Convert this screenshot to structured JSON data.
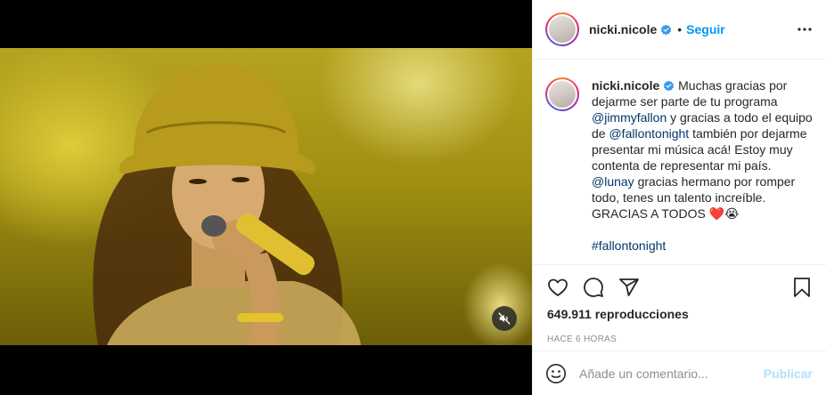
{
  "post": {
    "username": "nicki.nicole",
    "separator": "•",
    "follow_label": "Seguir",
    "more_icon": "more-options-icon",
    "verified_color": "#3897f0"
  },
  "caption": {
    "username": "nicki.nicole",
    "line1": " Muchas gracias por",
    "line2": "dejarme ser parte de tu programa",
    "mention1": "@jimmyfallon",
    "line3_rest": " y gracias a todo el equipo",
    "line4_pre": "de ",
    "mention2": "@fallontonight",
    "line4_rest": " también por dejarme",
    "line5": "presentar mi música acá! Estoy muy",
    "line6": "contenta de representar mi país.",
    "mention3": "@lunay",
    "line7_rest": " gracias hermano por romper",
    "line8": "todo, tenes un talento increíble.",
    "line9": "GRACIAS A TODOS ",
    "emoji": "❤️😭",
    "hashtag": "#fallontonight"
  },
  "stats": {
    "views": "649.911 reproducciones",
    "time": "HACE 6 HORAS"
  },
  "comment": {
    "placeholder": "Añade un comentario...",
    "publish_label": "Publicar"
  },
  "colors": {
    "accent": "#0095f6",
    "mention": "#00376b",
    "publish_disabled": "#b2dffc"
  }
}
